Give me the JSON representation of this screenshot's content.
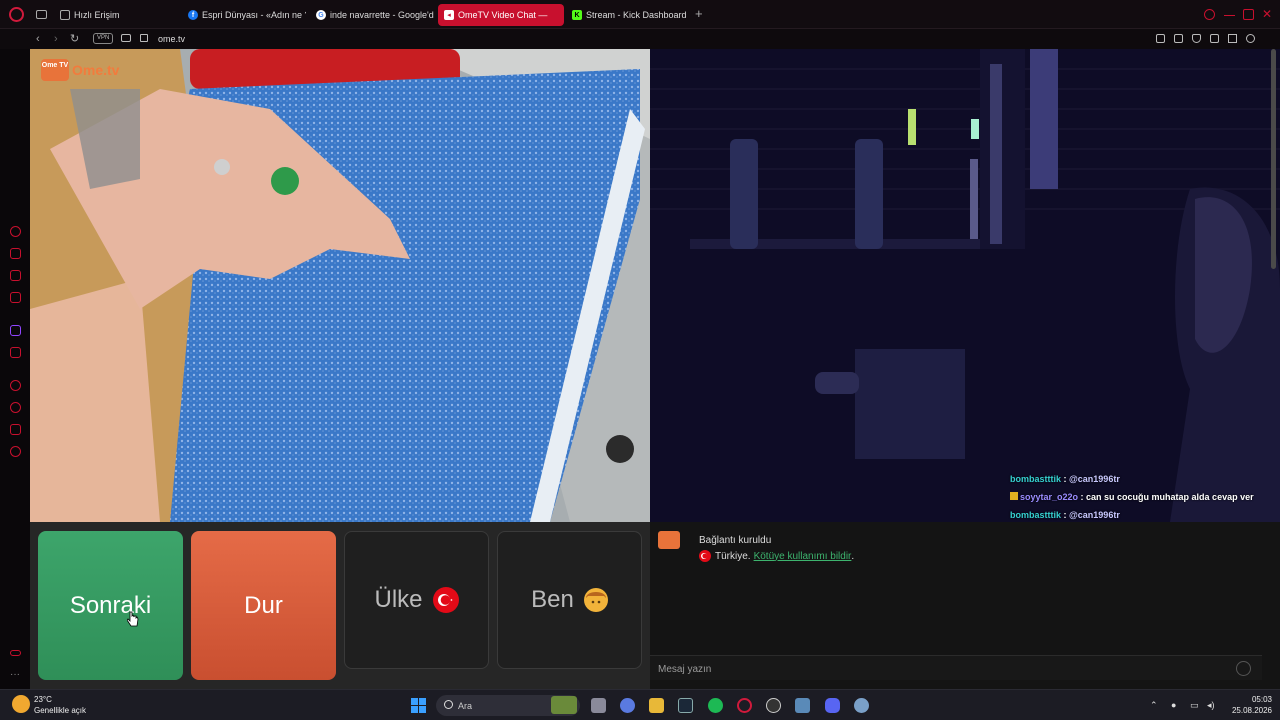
{
  "browser": {
    "tabs": [
      {
        "label": "Hızlı Erişim",
        "icon": "speed-dial-icon",
        "active": false
      },
      {
        "label": "Espri Dünyası - «Adın ne ?",
        "icon": "facebook-icon",
        "active": false
      },
      {
        "label": "inde navarrette - Google'da",
        "icon": "google-icon",
        "active": false
      },
      {
        "label": "OmeTV Video Chat — ",
        "icon": "ometv-icon",
        "active": true
      },
      {
        "label": "Stream - Kick Dashboard",
        "icon": "kick-icon",
        "active": false
      }
    ],
    "vpn_label": "VPN",
    "url": "ome.tv",
    "accent": "#c8102e"
  },
  "video": {
    "logo_text": "Ome.tv",
    "logo_badge": "Ome TV",
    "overlay_chat": [
      {
        "user": "bombastttik",
        "sep": " : ",
        "text": "@can1996tr",
        "color_class": "u1"
      },
      {
        "user": "soyytar_o22o",
        "sep": " : ",
        "text": "can su cocuğu muhatap alda cevap ver",
        "color_class": "u2"
      },
      {
        "user": "bombastttik",
        "sep": " : ",
        "text": "@can1996tr",
        "color_class": "u1"
      }
    ]
  },
  "controls": {
    "next_label": "Sonraki",
    "stop_label": "Dur",
    "country_label": "Ülke",
    "me_label": "Ben",
    "next_color": "#3da56b",
    "stop_color": "#e56b47"
  },
  "chat": {
    "status": "Bağlantı kuruldu",
    "country": "Türkiye.",
    "report_link": "Kötüye kullanımı bildir",
    "report_suffix": ".",
    "input_placeholder": "Mesaj yazın"
  },
  "taskbar": {
    "temperature": "23°C",
    "weather": "Genellikle açık",
    "search_placeholder": "Ara",
    "time": "05:03",
    "date": "25.08.2026"
  }
}
